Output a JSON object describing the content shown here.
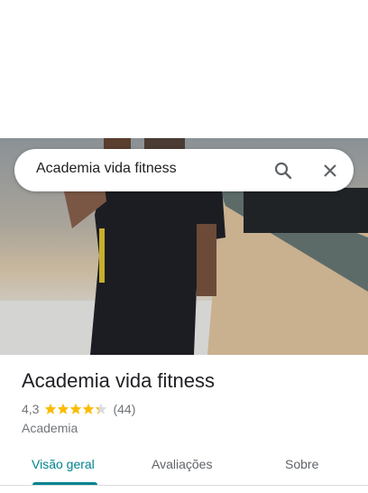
{
  "search": {
    "value": "Academia vida fitness",
    "search_icon": "search-icon",
    "close_icon": "close-icon"
  },
  "place": {
    "name": "Academia vida fitness",
    "rating": "4,3",
    "rating_value": 4.3,
    "rating_max": 5,
    "review_count": "(44)",
    "category": "Academia",
    "star_color": "#fbbc04"
  },
  "tabs": [
    {
      "label": "Visão geral",
      "active": true
    },
    {
      "label": "Avaliações",
      "active": false
    },
    {
      "label": "Sobre",
      "active": false
    }
  ],
  "accent": "#00838f"
}
